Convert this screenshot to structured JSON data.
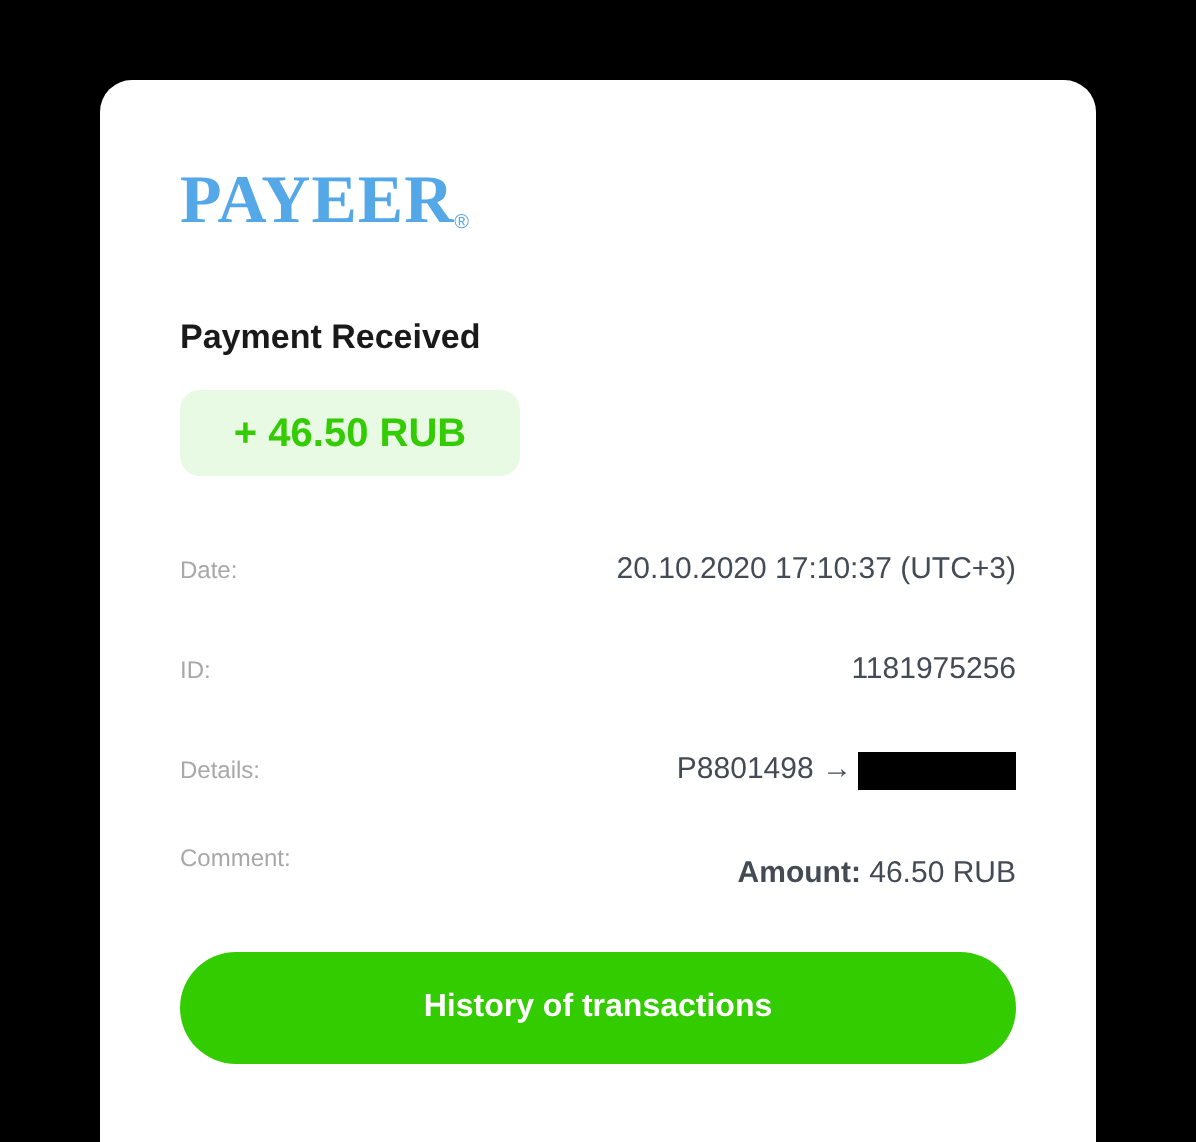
{
  "logo": {
    "text": "PAYEER",
    "mark": "®"
  },
  "title": "Payment Received",
  "amount_badge": "+ 46.50 RUB",
  "rows": [
    {
      "label": "Date:",
      "value": "20.10.2020 17:10:37 (UTC+3)",
      "redacted": false
    },
    {
      "label": "ID:",
      "value": "1181975256",
      "redacted": false
    },
    {
      "label": "Details:",
      "value": "P8801498 →",
      "redacted": true
    },
    {
      "label": "Comment:",
      "value": "**Amount:** 46.50 RUB",
      "redacted": false
    }
  ],
  "button": "History of transactions"
}
